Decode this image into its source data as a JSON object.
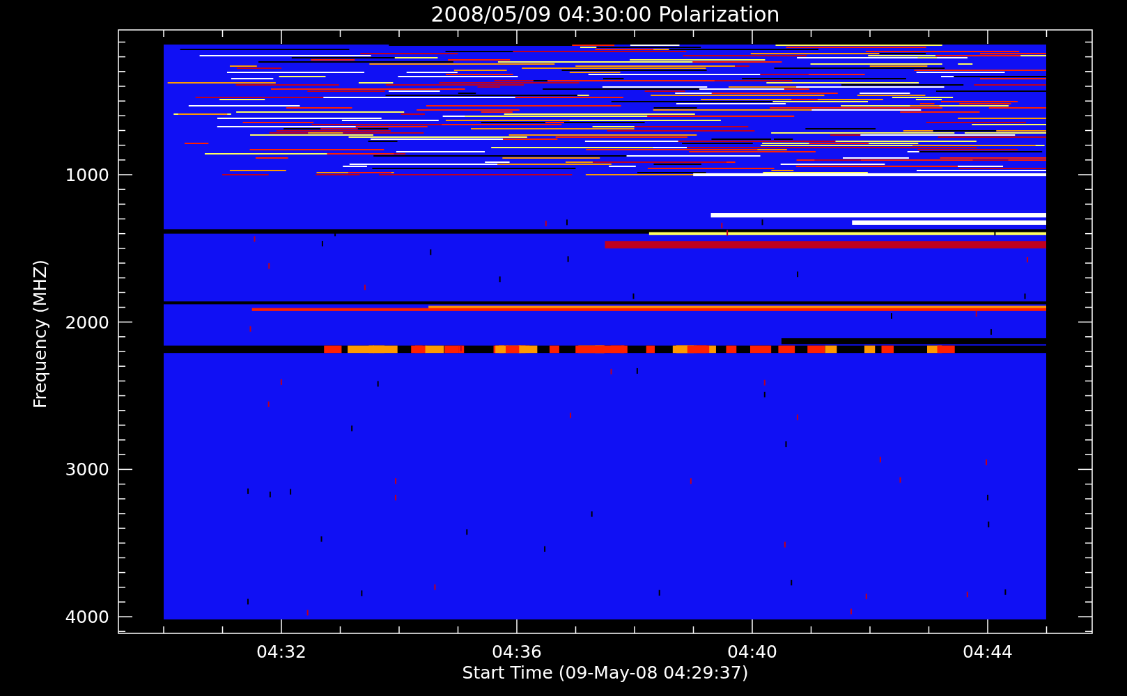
{
  "title": "2008/05/09 04:30:00 Polarization",
  "x_axis": {
    "label": "Start Time (09-May-08 04:29:37)",
    "ticks": [
      {
        "label": "04:32"
      },
      {
        "label": "04:36"
      },
      {
        "label": "04:40"
      },
      {
        "label": "04:44"
      }
    ]
  },
  "y_axis": {
    "label": "Frequency (MHZ)",
    "ticks": [
      {
        "label": "1000"
      },
      {
        "label": "2000"
      },
      {
        "label": "3000"
      },
      {
        "label": "4000"
      }
    ]
  }
}
